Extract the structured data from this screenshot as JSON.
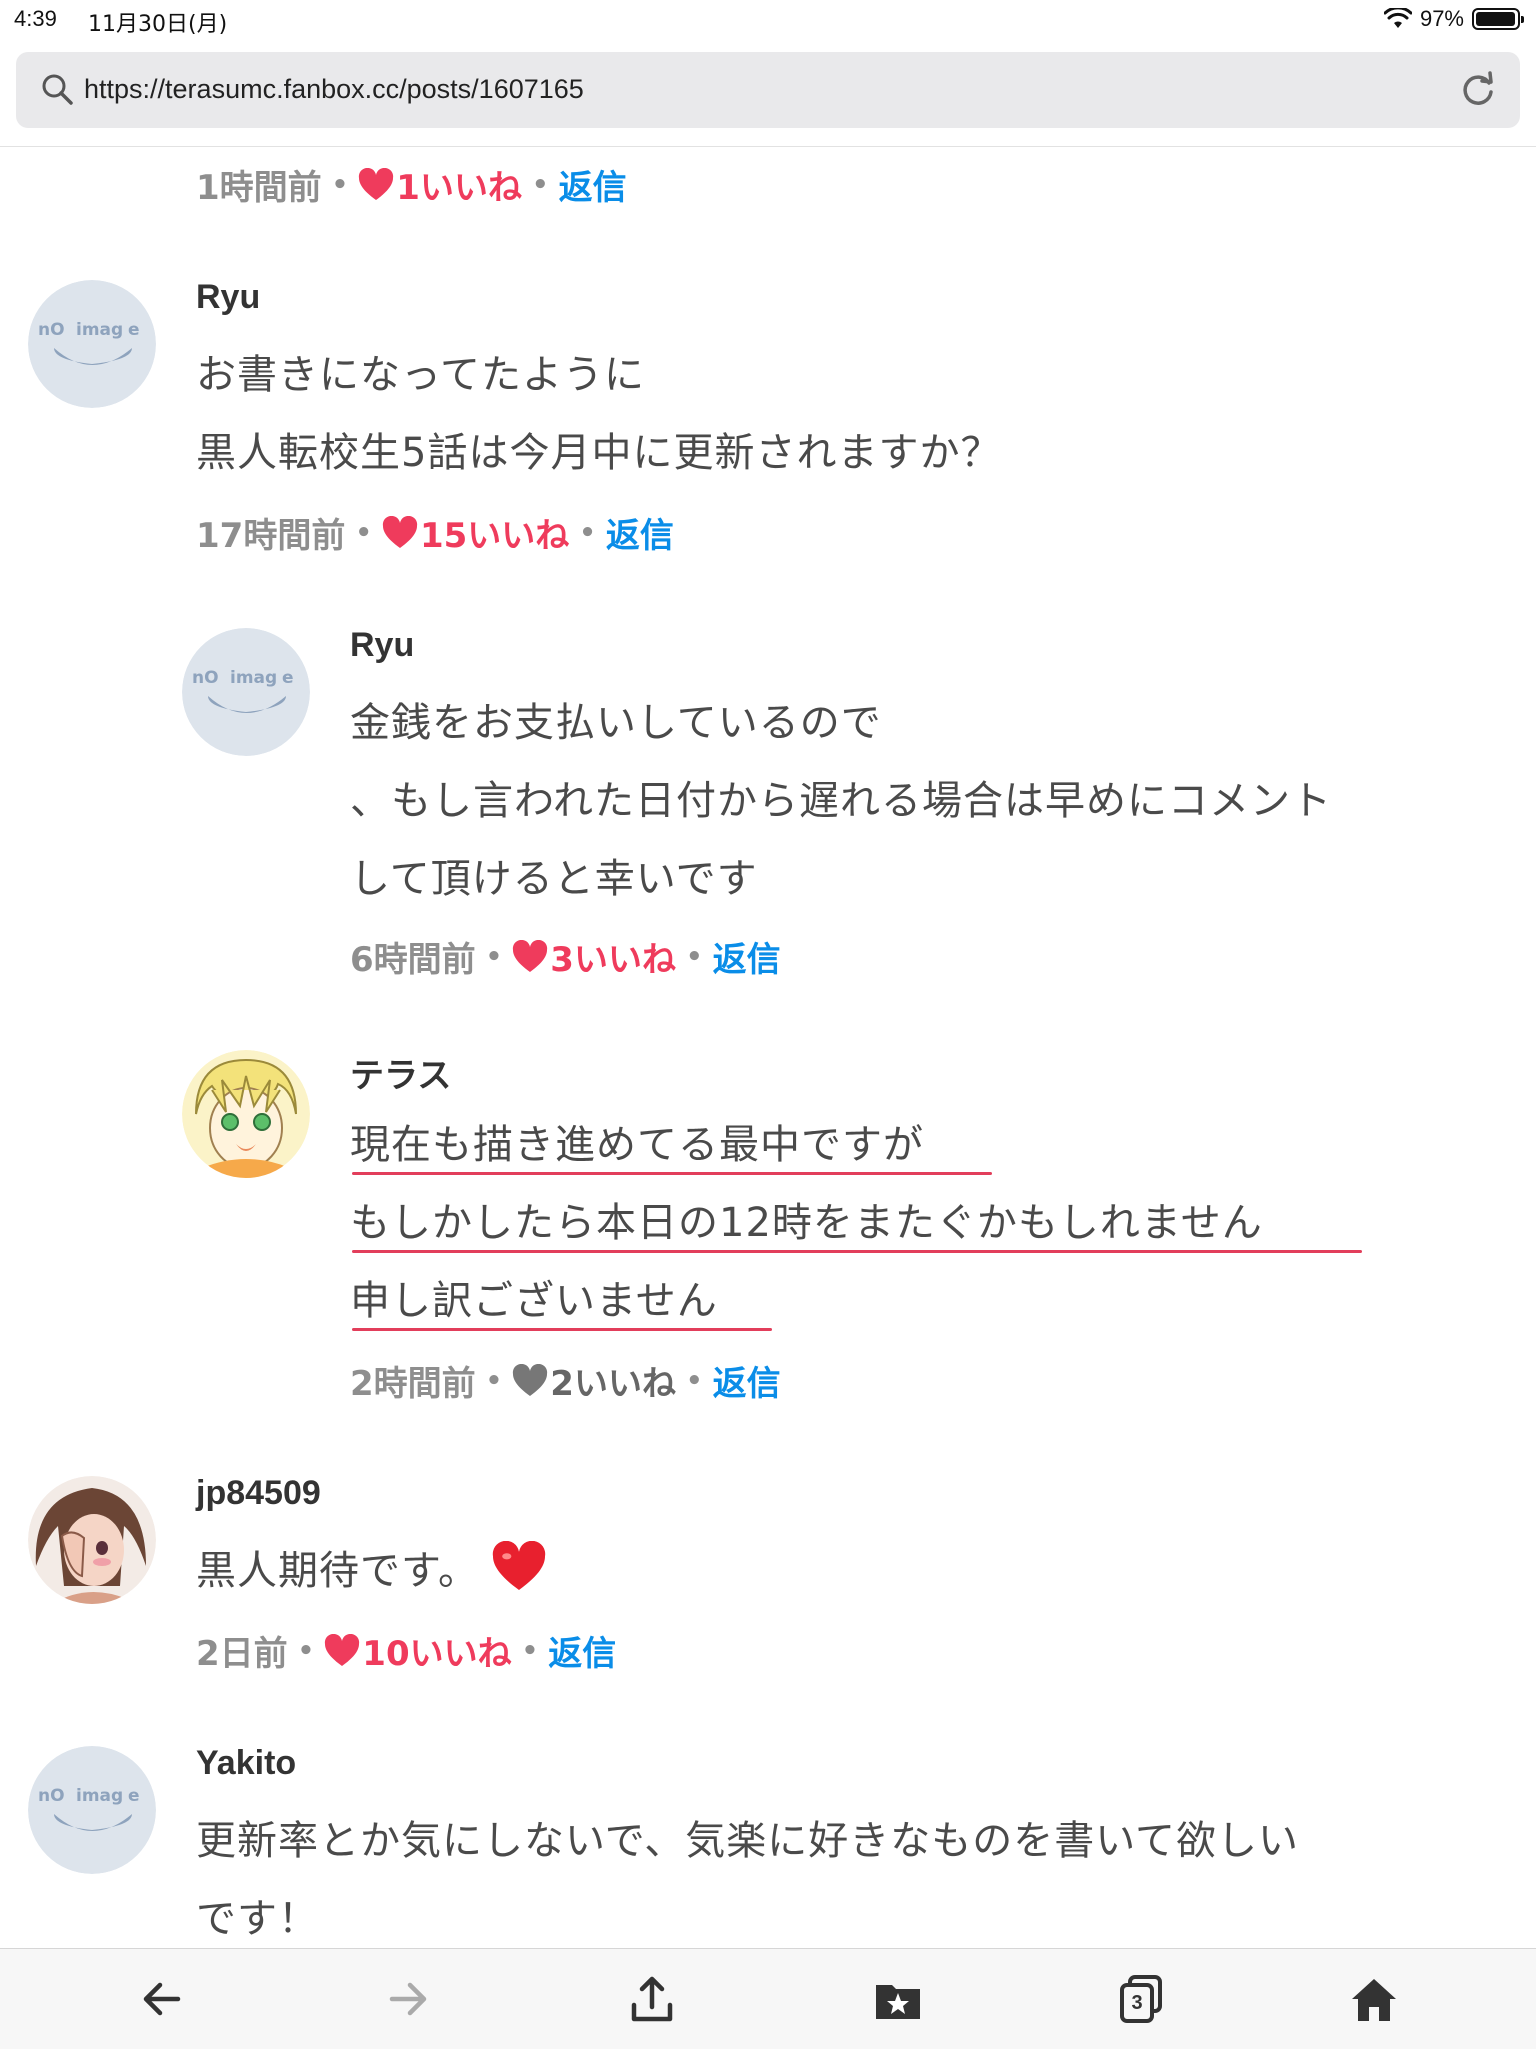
{
  "status_bar": {
    "time": "4:39",
    "date": "11月30日(月)",
    "battery": "97%",
    "battery_level": 0.97
  },
  "browser": {
    "url": "https://terasumc.fanbox.cc/posts/1607165",
    "tabs_count": "3"
  },
  "comments": [
    {
      "time": "1時間前",
      "likes": "1いいね",
      "reply": "返信"
    },
    {
      "author": "Ryu",
      "lines": [
        "お書きになってたように",
        "黒人転校生5話は今月中に更新されますか？"
      ],
      "time": "17時間前",
      "likes": "15いいね",
      "reply": "返信"
    },
    {
      "author": "Ryu",
      "lines": [
        "金銭をお支払いしているので",
        "、もし言われた日付から遅れる場合は早めにコメント",
        "して頂けると幸いです"
      ],
      "time": "6時間前",
      "likes": "3いいね",
      "reply": "返信"
    },
    {
      "author": "テラス",
      "lines": [
        "現在も描き進めてる最中ですが",
        "もしかしたら本日の12時をまたぐかもしれません",
        "申し訳ございません"
      ],
      "time": "2時間前",
      "likes": "2いいね",
      "reply": "返信"
    },
    {
      "author": "jp84509",
      "lines": [
        "黒人期待です。"
      ],
      "time": "2日前",
      "likes": "10いいね",
      "reply": "返信"
    },
    {
      "author": "Yakito",
      "lines": [
        "更新率とか気にしないで、気楽に好きなものを書いて欲しい",
        "です！"
      ]
    }
  ],
  "avatar_placeholder": {
    "text_left": "nO",
    "text_right": "imag",
    "text_e": "e"
  },
  "colors": {
    "like": "#ef3b5c",
    "reply": "#0a8de8",
    "meta": "#8e8e8e",
    "underline": "#e23e5b"
  }
}
